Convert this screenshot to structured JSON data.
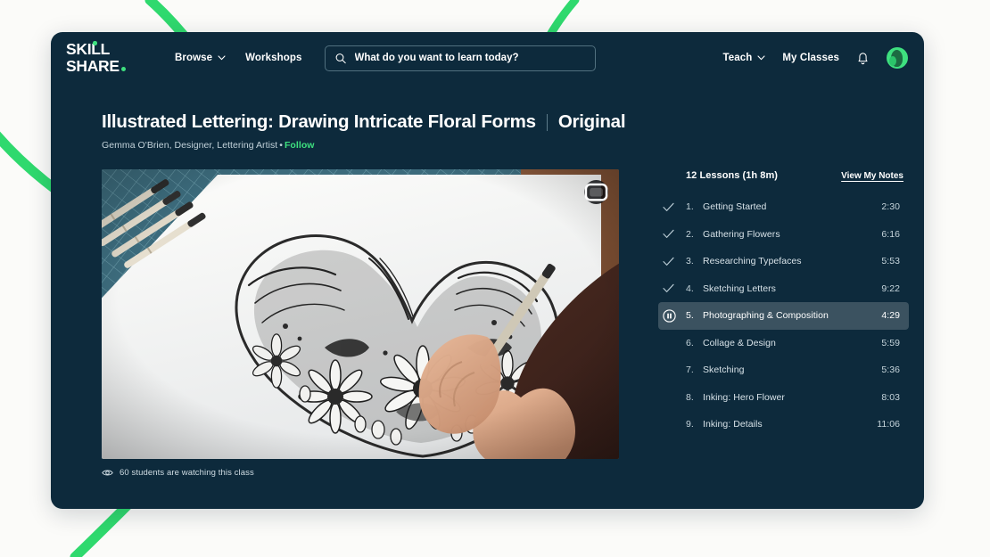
{
  "brand": {
    "logo_line1": "Skill",
    "logo_line2": "share",
    "accent_green": "#3ee07f",
    "card_bg": "#0d2a3c",
    "page_bg": "#fbfbf9"
  },
  "header": {
    "nav_left": [
      {
        "label": "Browse",
        "has_chevron": true,
        "icon": "chevron-down-icon"
      },
      {
        "label": "Workshops",
        "has_chevron": false,
        "icon": ""
      }
    ],
    "search": {
      "placeholder": "What do you want to learn today?",
      "value": "",
      "icon": "search-icon"
    },
    "nav_right": [
      {
        "label": "Teach",
        "has_chevron": true,
        "icon": "chevron-down-icon"
      },
      {
        "label": "My Classes",
        "has_chevron": false,
        "icon": ""
      }
    ],
    "bell_icon": "notification-bell-icon",
    "avatar_icon": "user-avatar"
  },
  "course": {
    "title": "Illustrated Lettering: Drawing Intricate Floral Forms",
    "badge": "Original",
    "author": "Gemma O'Brien, Designer, Lettering Artist",
    "bullet": "•",
    "follow_label": "Follow"
  },
  "video": {
    "pip_icon": "picture-in-picture-icon",
    "eye_icon": "eye-icon",
    "watching_text": "60 students are watching this class"
  },
  "lessons_panel": {
    "count_label": "12 Lessons (1h 8m)",
    "notes_link": "View My Notes",
    "items": [
      {
        "num": "1.",
        "title": "Getting Started",
        "duration": "2:30",
        "state": "completed",
        "icon": "check-icon"
      },
      {
        "num": "2.",
        "title": "Gathering Flowers",
        "duration": "6:16",
        "state": "completed",
        "icon": "check-icon"
      },
      {
        "num": "3.",
        "title": "Researching Typefaces",
        "duration": "5:53",
        "state": "completed",
        "icon": "check-icon"
      },
      {
        "num": "4.",
        "title": "Sketching Letters",
        "duration": "9:22",
        "state": "completed",
        "icon": "check-icon"
      },
      {
        "num": "5.",
        "title": "Photographing & Composition",
        "duration": "4:29",
        "state": "playing",
        "icon": "pause-icon"
      },
      {
        "num": "6.",
        "title": "Collage & Design",
        "duration": "5:59",
        "state": "default",
        "icon": ""
      },
      {
        "num": "7.",
        "title": "Sketching",
        "duration": "5:36",
        "state": "default",
        "icon": ""
      },
      {
        "num": "8.",
        "title": "Inking: Hero Flower",
        "duration": "8:03",
        "state": "default",
        "icon": ""
      },
      {
        "num": "9.",
        "title": "Inking: Details",
        "duration": "11:06",
        "state": "default",
        "icon": ""
      }
    ]
  }
}
